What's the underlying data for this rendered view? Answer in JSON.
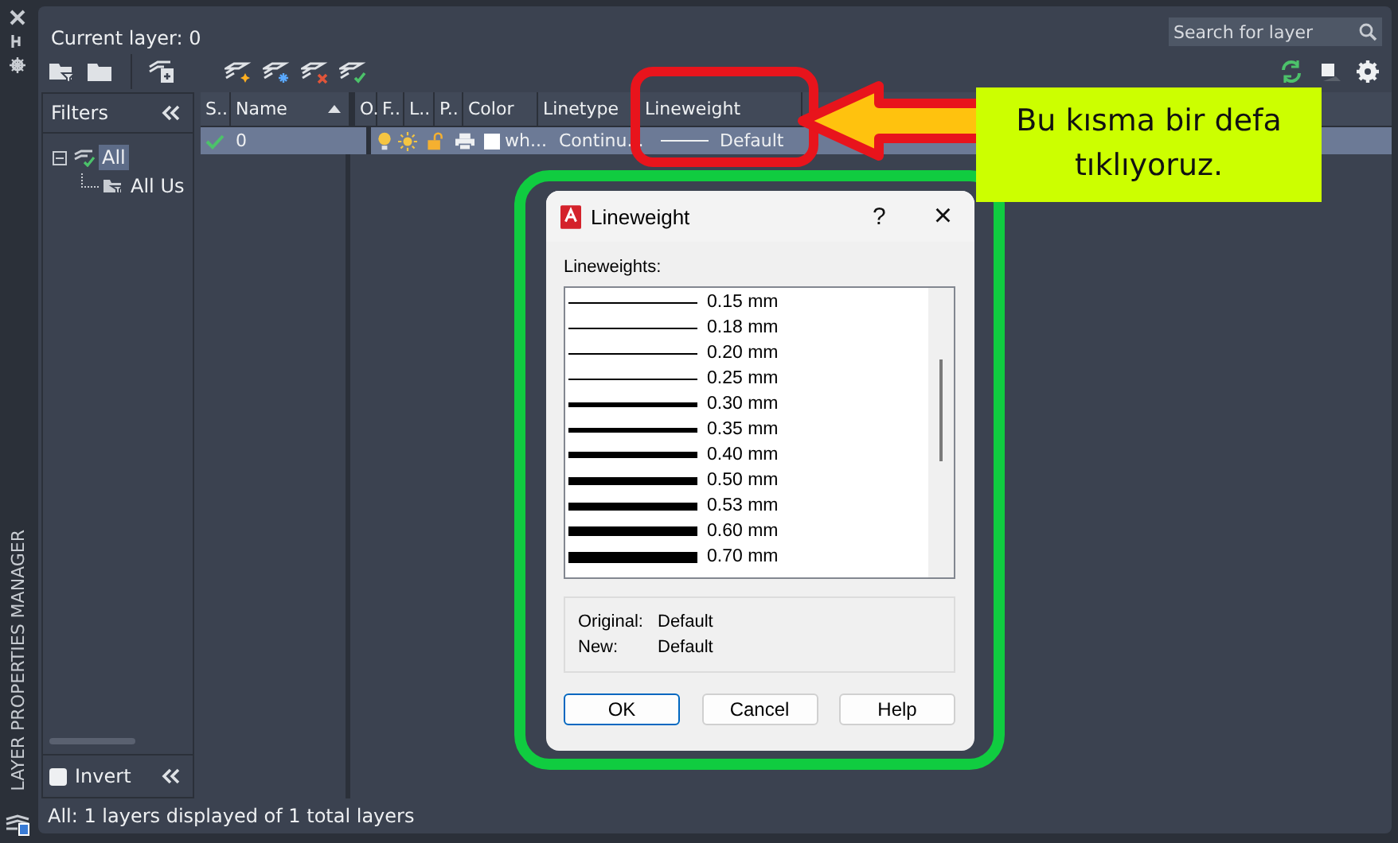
{
  "side_strip": {
    "title": "LAYER PROPERTIES MANAGER"
  },
  "header": {
    "current_layer": "Current layer: 0",
    "search": {
      "placeholder": "Search for layer"
    }
  },
  "filters": {
    "title": "Filters",
    "tree": [
      {
        "label": "All",
        "selected": true,
        "expanded": true,
        "children": [
          {
            "label": "All Us",
            "selected": false
          }
        ]
      }
    ],
    "invert": {
      "label": "Invert",
      "checked": false
    }
  },
  "table": {
    "columns": [
      "S..",
      "Name",
      "O.",
      "F..",
      "L..",
      "P..",
      "Color",
      "Linetype",
      "Lineweight"
    ],
    "rows": [
      {
        "selected": true,
        "current": true,
        "name": "0",
        "on": true,
        "frozen": false,
        "locked": false,
        "plot": true,
        "color_name": "wh...",
        "linetype": "Continu...",
        "lineweight": "Default"
      }
    ]
  },
  "status_bar": "All: 1 layers displayed of 1 total layers",
  "dialog": {
    "title": "Lineweight",
    "help": "?",
    "close": "×",
    "list_label": "Lineweights:",
    "items": [
      {
        "label": "0.15 mm",
        "selected": false
      },
      {
        "label": "0.18 mm",
        "selected": false
      },
      {
        "label": "0.20 mm",
        "selected": false
      },
      {
        "label": "0.25 mm",
        "selected": false
      },
      {
        "label": "0.30 mm",
        "selected": false
      },
      {
        "label": "0.35 mm",
        "selected": false
      },
      {
        "label": "0.40 mm",
        "selected": false
      },
      {
        "label": "0.50 mm",
        "selected": false
      },
      {
        "label": "0.53 mm",
        "selected": false
      },
      {
        "label": "0.60 mm",
        "selected": false
      },
      {
        "label": "0.70 mm",
        "selected": false
      }
    ],
    "original_label": "Original:",
    "original_value": "Default",
    "new_label": "New:",
    "new_value": "Default",
    "buttons": [
      {
        "label": "OK",
        "selected": true
      },
      {
        "label": "Cancel",
        "selected": false
      },
      {
        "label": "Help",
        "selected": false
      }
    ]
  },
  "callout": {
    "text": "Bu kısma bir defa tıklıyoruz."
  }
}
